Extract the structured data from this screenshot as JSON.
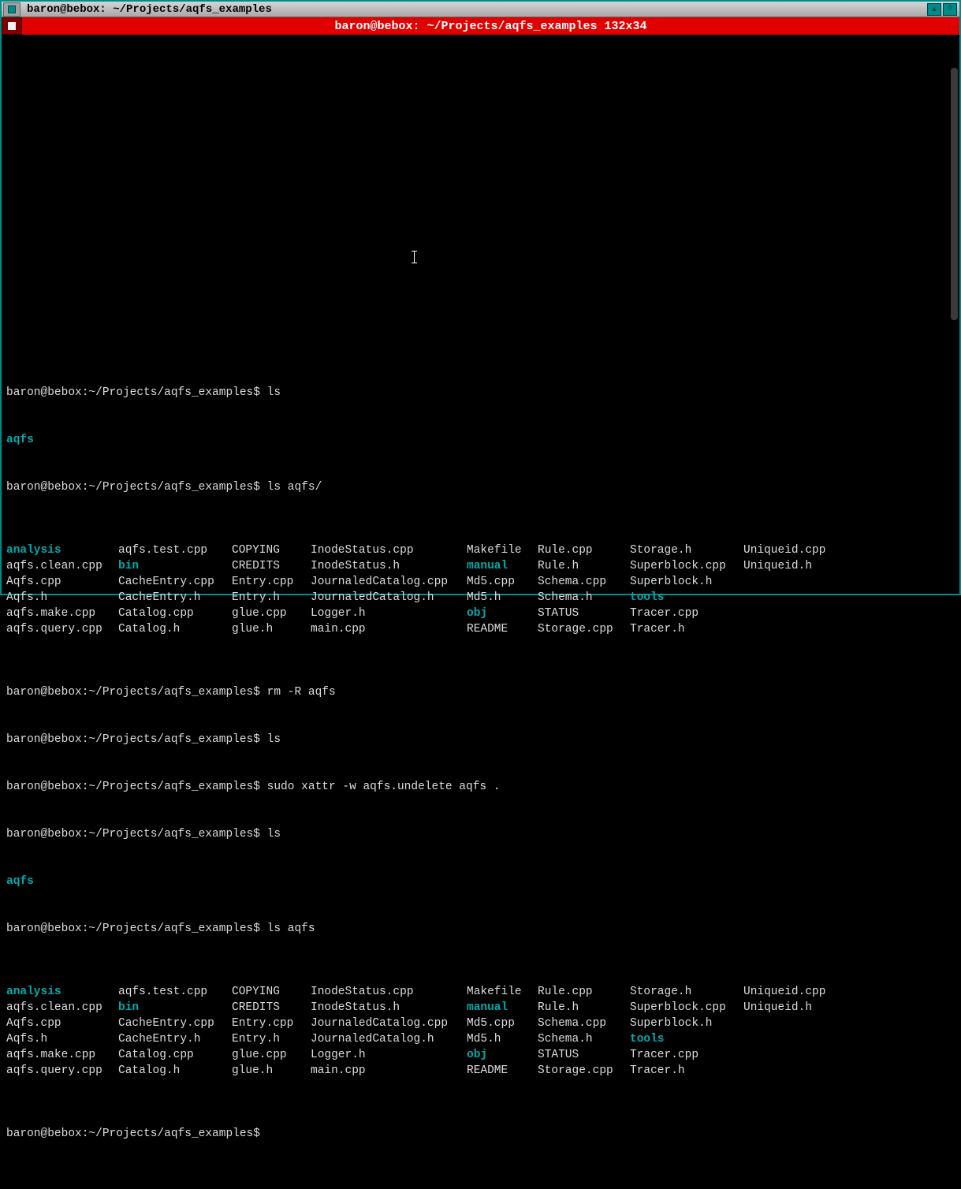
{
  "window": {
    "title": "baron@bebox: ~/Projects/aqfs_examples",
    "subtitle": "baron@bebox: ~/Projects/aqfs_examples 132x34"
  },
  "prompt": "baron@bebox:~/Projects/aqfs_examples$ ",
  "commands": {
    "ls1": "ls",
    "ls_aqfs_slash": "ls aqfs/",
    "rm": "rm -R aqfs",
    "ls2": "ls",
    "undelete": "sudo xattr -w aqfs.undelete aqfs .",
    "ls3": "ls",
    "ls_aqfs": "ls aqfs"
  },
  "single_entry": "aqfs",
  "ls_cols": [
    [
      "analysis",
      "aqfs.clean.cpp",
      "Aqfs.cpp",
      "Aqfs.h",
      "aqfs.make.cpp",
      "aqfs.query.cpp"
    ],
    [
      "aqfs.test.cpp",
      "bin",
      "CacheEntry.cpp",
      "CacheEntry.h",
      "Catalog.cpp",
      "Catalog.h"
    ],
    [
      "COPYING",
      "CREDITS",
      "Entry.cpp",
      "Entry.h",
      "glue.cpp",
      "glue.h"
    ],
    [
      "InodeStatus.cpp",
      "InodeStatus.h",
      "JournaledCatalog.cpp",
      "JournaledCatalog.h",
      "Logger.h",
      "main.cpp"
    ],
    [
      "Makefile",
      "manual",
      "Md5.cpp",
      "Md5.h",
      "obj",
      "README"
    ],
    [
      "Rule.cpp",
      "Rule.h",
      "Schema.cpp",
      "Schema.h",
      "STATUS",
      "Storage.cpp"
    ],
    [
      "Storage.h",
      "Superblock.cpp",
      "Superblock.h",
      "tools",
      "Tracer.cpp",
      "Tracer.h"
    ],
    [
      "Uniqueid.cpp",
      "Uniqueid.h",
      "",
      "",
      "",
      ""
    ]
  ],
  "dir_entries": [
    "analysis",
    "bin",
    "manual",
    "obj",
    "tools"
  ]
}
